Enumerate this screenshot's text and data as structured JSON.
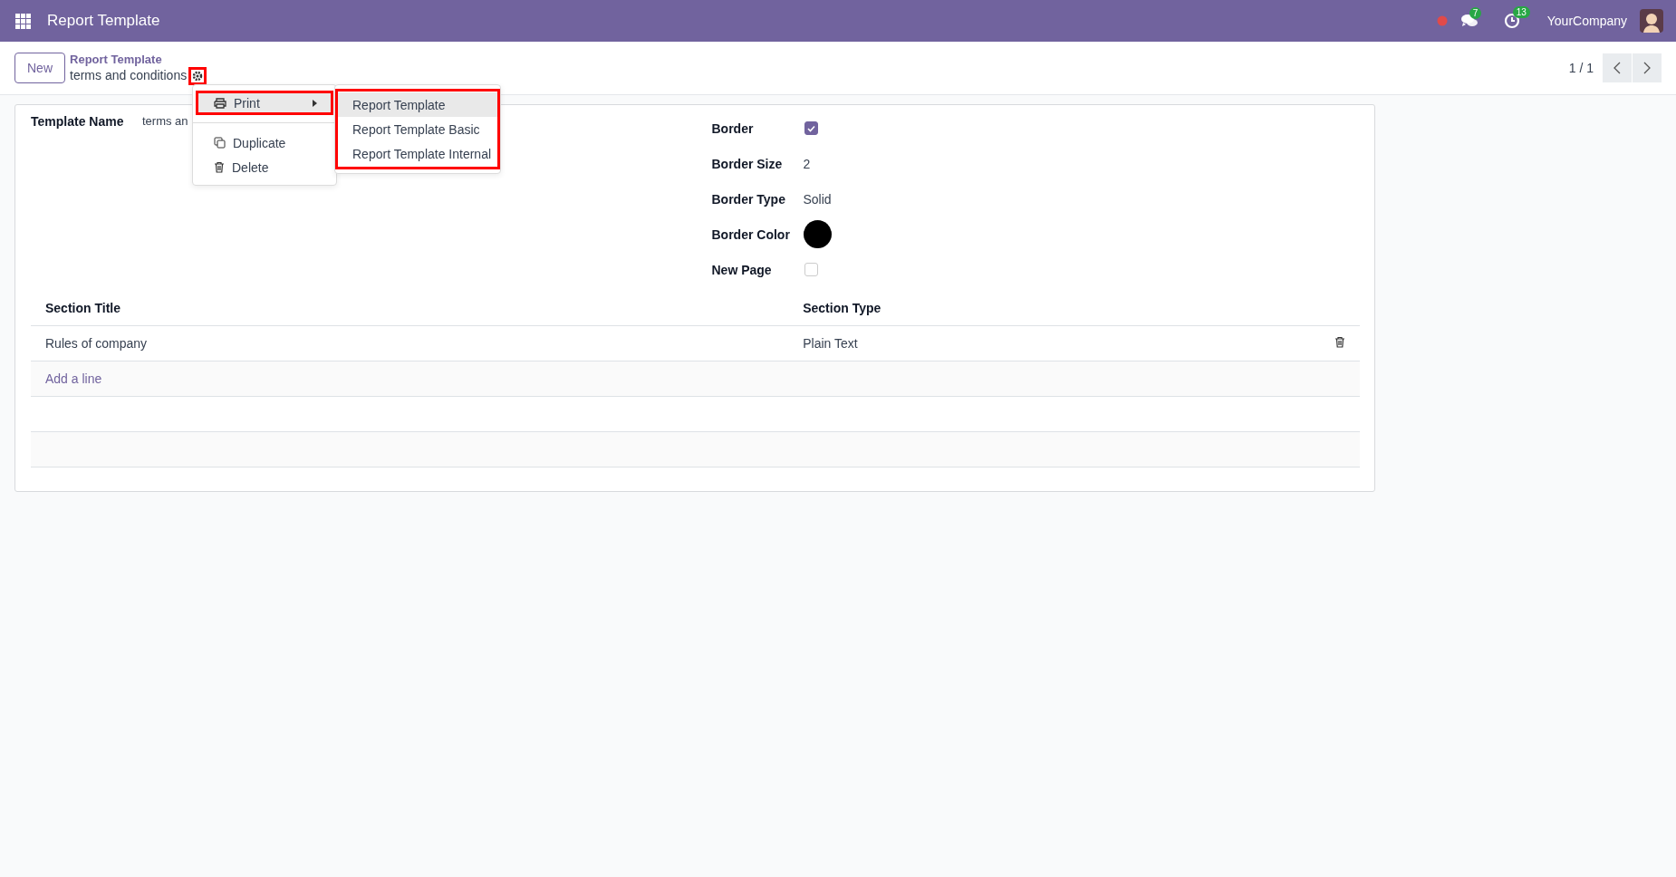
{
  "navbar": {
    "app_title": "Report Template",
    "messages_badge": "7",
    "activities_badge": "13",
    "company": "YourCompany"
  },
  "control_panel": {
    "new_button": "New",
    "breadcrumb_parent": "Report Template",
    "record_name": "terms and conditions",
    "gear_annotated": true,
    "pager": "1 / 1"
  },
  "action_menu": {
    "items": [
      {
        "kind": "submenu",
        "label": "Print",
        "active": true,
        "annotated": true
      },
      {
        "kind": "divider"
      },
      {
        "kind": "item",
        "label": "Duplicate",
        "active": false,
        "annotated": false
      },
      {
        "kind": "item",
        "label": "Delete",
        "active": false,
        "annotated": false
      }
    ],
    "submenu": {
      "annotated": true,
      "items": [
        {
          "label": "Report Template",
          "active": true
        },
        {
          "label": "Report Template Basic",
          "active": false
        },
        {
          "label": "Report Template Internal",
          "active": false
        }
      ]
    }
  },
  "form": {
    "left_fields": [
      {
        "label": "Template Name",
        "kind": "text",
        "value": "terms an"
      }
    ],
    "right_fields": [
      {
        "label": "Border",
        "kind": "checkbox",
        "checked": true
      },
      {
        "label": "Border Size",
        "kind": "text",
        "value": "2"
      },
      {
        "label": "Border Type",
        "kind": "text",
        "value": "Solid"
      },
      {
        "label": "Border Color",
        "kind": "color",
        "color": "#000000"
      },
      {
        "label": "New Page",
        "kind": "checkbox",
        "checked": false
      }
    ]
  },
  "sections_table": {
    "columns": [
      "Section Title",
      "Section Type"
    ],
    "rows": [
      {
        "section_title": "Rules of company",
        "section_type": "Plain Text"
      }
    ],
    "add_line": "Add a line"
  }
}
